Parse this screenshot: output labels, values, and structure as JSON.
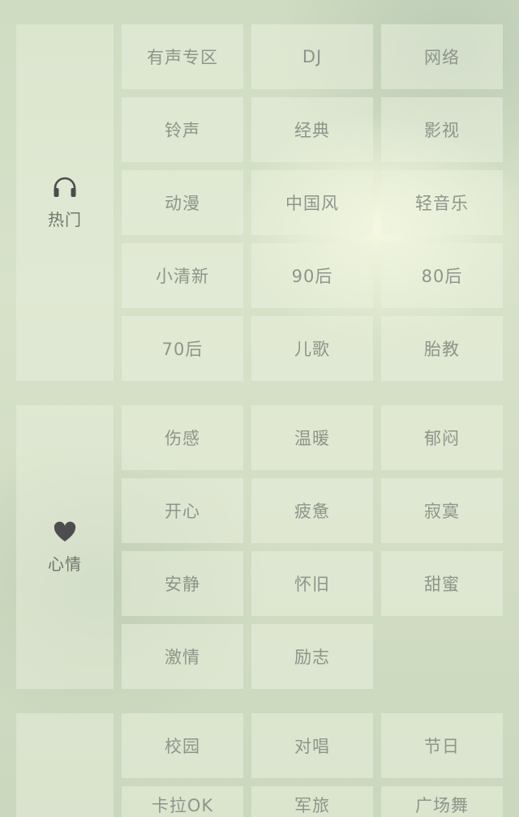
{
  "sections": [
    {
      "label": "热门",
      "icon": "headphones-icon",
      "tiles": [
        "有声专区",
        "DJ",
        "网络",
        "铃声",
        "经典",
        "影视",
        "动漫",
        "中国风",
        "轻音乐",
        "小清新",
        "90后",
        "80后",
        "70后",
        "儿歌",
        "胎教"
      ]
    },
    {
      "label": "心情",
      "icon": "heart-icon",
      "tiles": [
        "伤感",
        "温暖",
        "郁闷",
        "开心",
        "疲惫",
        "寂寞",
        "安静",
        "怀旧",
        "甜蜜",
        "激情",
        "励志"
      ]
    },
    {
      "label": "",
      "icon": "",
      "tiles": [
        "校园",
        "对唱",
        "节日",
        "卡拉OK",
        "军旅",
        "广场舞"
      ]
    }
  ]
}
